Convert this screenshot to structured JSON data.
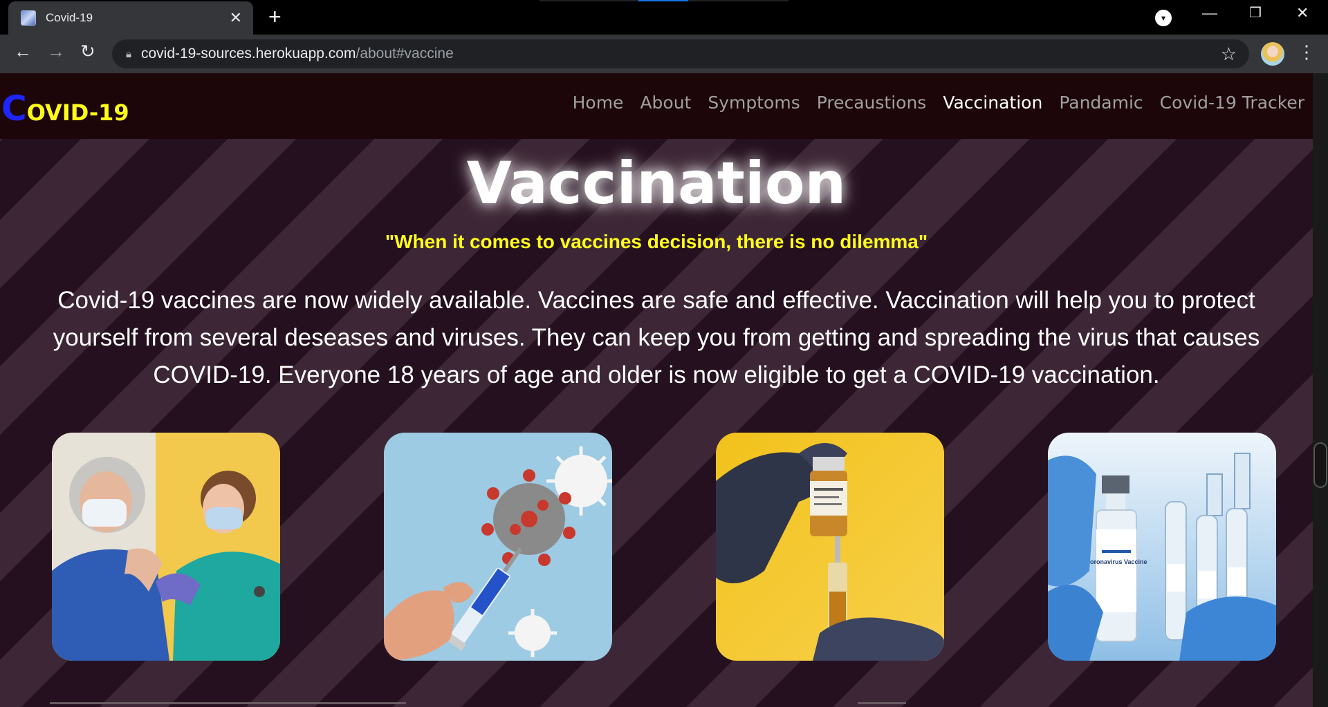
{
  "browser": {
    "tab_title": "Covid-19",
    "new_tab_icon": "+",
    "close_icon": "✕",
    "url_host": "covid-19-sources.herokuapp.com",
    "url_path": "/about#vaccine"
  },
  "site": {
    "logo_first": "C",
    "logo_rest": "OVID-19",
    "nav": {
      "home": "Home",
      "about": "About",
      "symptoms": "Symptoms",
      "precaustions": "Precaustions",
      "vaccination": "Vaccination",
      "pandamic": "Pandamic",
      "tracker": "Covid-19 Tracker"
    },
    "active_nav": "Vaccination"
  },
  "section": {
    "title": "Vaccination",
    "quote": "\"When it comes to vaccines decision, there is no dilemma\"",
    "paragraph": "Covid-19 vaccines are now widely available. Vaccines are safe and effective. Vaccination will help you to protect yourself from several deseases and viruses. They can keep you from getting and spreading the virus that causes COVID-19. Everyone 18 years of age and older is now eligible to get a COVID-19 vaccination."
  },
  "images": {
    "card1": "nurse-vaccinating-patient-image",
    "card2": "syringe-and-virus-image",
    "card3": "gloved-hands-filling-syringe-image",
    "card4": "coronavirus-vaccine-vials-image",
    "vial_label": "Coronavirus Vaccine"
  },
  "colors": {
    "logo_yellow": "#ffff1a",
    "logo_blue": "#1f25ff",
    "quote_yellow": "#ffff1a",
    "nav_bg": "#1c0609"
  }
}
